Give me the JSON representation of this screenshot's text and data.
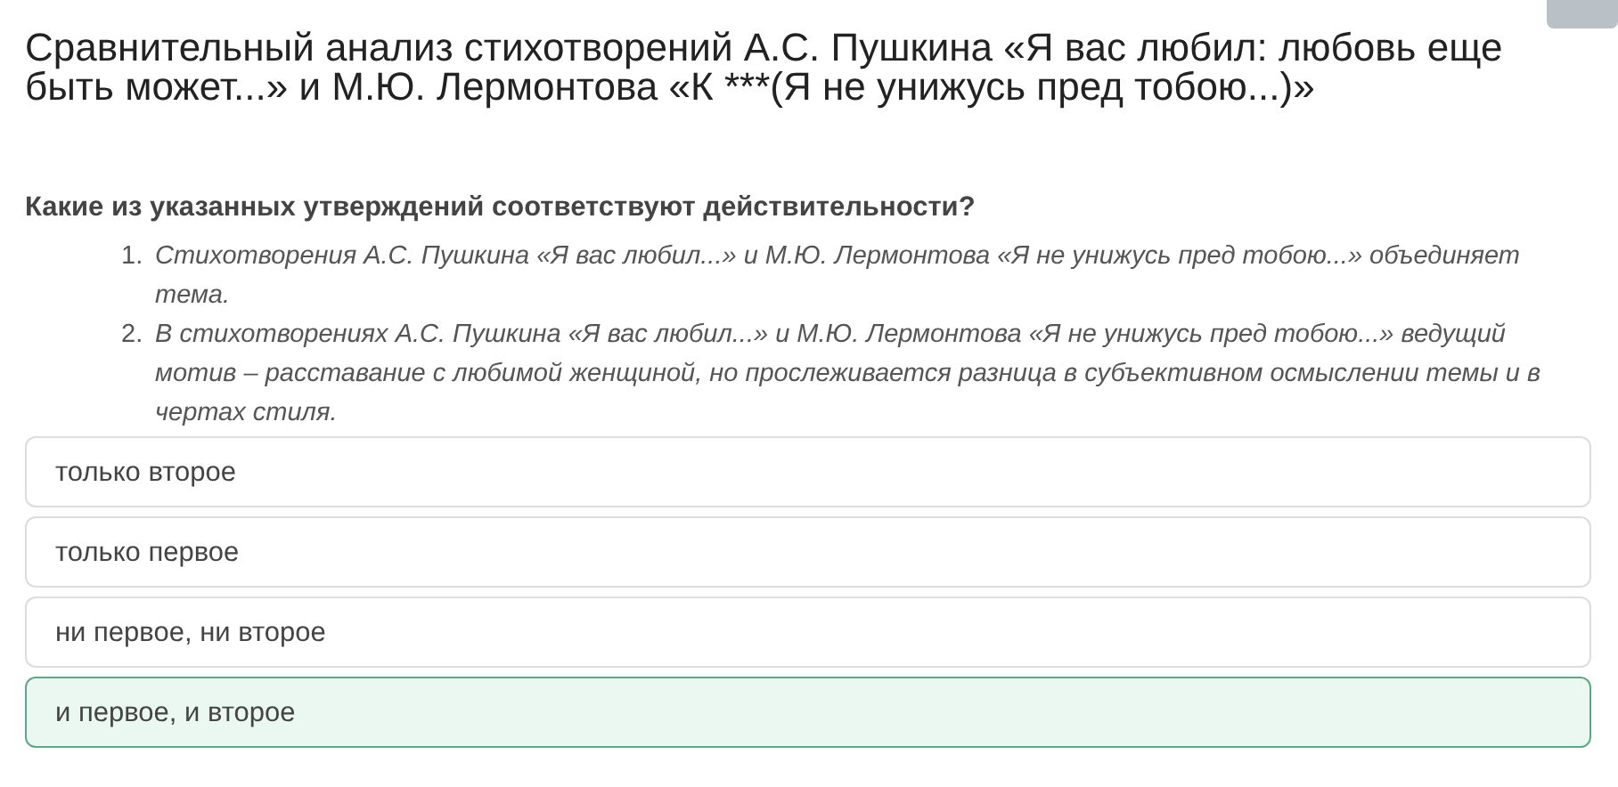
{
  "title": "Сравнительный анализ стихотворений А.С. Пушкина «Я вас любил: любовь еще быть может...» и М.Ю. Лермонтова «К ***(Я не унижусь пред тобою...)»",
  "question": "Какие из указанных утверждений соответствуют действительности?",
  "statements": [
    {
      "number": "1.",
      "text": "Стихотворения А.С. Пушкина «Я вас любил...» и М.Ю. Лермонтова «Я не унижусь пред тобою...» объединяет тема."
    },
    {
      "number": "2.",
      "text": "В стихотворениях А.С. Пушкина «Я вас любил...» и М.Ю. Лермонтова «Я не унижусь пред тобою...» ведущий мотив – расставание с любимой женщиной, но прослеживается разница в субъективном осмыслении темы и в чертах стиля."
    }
  ],
  "options": [
    {
      "label": "только второе",
      "selected": false
    },
    {
      "label": "только первое",
      "selected": false
    },
    {
      "label": "ни первое, ни второе",
      "selected": false
    },
    {
      "label": "и первое, и второе",
      "selected": true
    }
  ]
}
